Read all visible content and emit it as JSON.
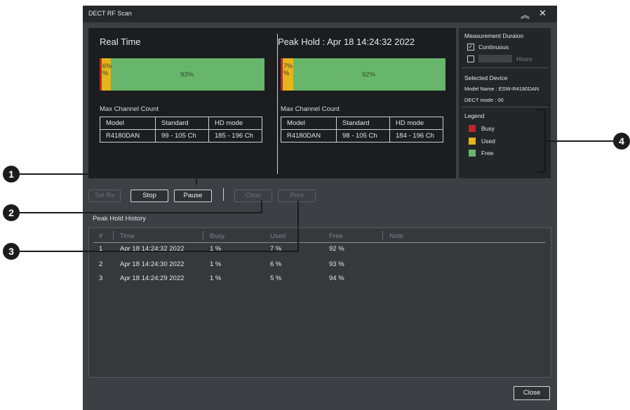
{
  "window": {
    "title": "DECT RF Scan",
    "collapse_icon": "chevron-up-icon",
    "close_icon": "close-icon",
    "collapse_glyph": "︽",
    "close_glyph": "✕"
  },
  "realtime": {
    "title": "Real Time",
    "busy_pct": 1,
    "used_pct": 6,
    "free_pct": 93,
    "used_label_a": "6%",
    "used_label_b": "%",
    "free_label": "93%",
    "max_channel_count_label": "Max Channel Count",
    "table_headers": [
      "Model",
      "Standard",
      "HD mode"
    ],
    "table_row": [
      "R4180DAN",
      "99 - 105 Ch",
      "185 - 196 Ch"
    ]
  },
  "peakhold": {
    "title": "Peak Hold : Apr 18 14:24:32 2022",
    "busy_pct": 1,
    "used_pct": 7,
    "free_pct": 92,
    "used_label_a": "7%",
    "used_label_b": "%",
    "free_label": "92%",
    "max_channel_count_label": "Max Channel Count",
    "table_headers": [
      "Model",
      "Standard",
      "HD mode"
    ],
    "table_row": [
      "R4180DAN",
      "98 - 105 Ch",
      "184 - 196 Ch"
    ]
  },
  "measurement": {
    "title": "Measurement Duraion",
    "continuous_label": "Continuous",
    "continuous_checked": "✓",
    "hours_label": "Hours"
  },
  "device": {
    "title": "Selected Device",
    "model_name": "Model Name : ESW-R4180DAN",
    "dect_mode": "DECT mode : 00"
  },
  "legend": {
    "title": "Legend",
    "items": [
      {
        "label": "Busy",
        "color": "#c0242d"
      },
      {
        "label": "Used",
        "color": "#e5b51a"
      },
      {
        "label": "Free",
        "color": "#68b66b"
      }
    ]
  },
  "toolbar": {
    "sel_rx": "Sel Rx",
    "stop": "Stop",
    "pause": "Pause",
    "clear": "Clear",
    "print": "Print"
  },
  "history": {
    "title": "Peak Hold History",
    "columns": [
      "#",
      "Time",
      "Busy",
      "Used",
      "Free",
      "Note"
    ],
    "rows": [
      [
        "1",
        "Apr 18 14:24:32 2022",
        "1  %",
        "7  %",
        "92  %"
      ],
      [
        "2",
        "Apr 18 14:24:30 2022",
        "1  %",
        "6  %",
        "93  %"
      ],
      [
        "3",
        "Apr 18 14:24:29 2022",
        "1  %",
        "5  %",
        "94  %"
      ]
    ]
  },
  "footer": {
    "close": "Close"
  },
  "callouts": [
    "1",
    "2",
    "3",
    "4"
  ]
}
